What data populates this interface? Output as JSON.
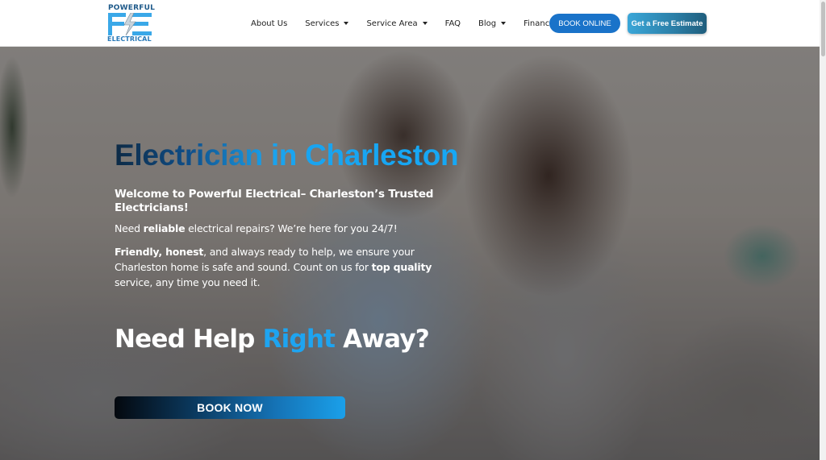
{
  "header": {
    "logo": {
      "top_text": "POWERFUL",
      "mark": "PE",
      "bottom_text": "ELECTRICAL",
      "brand_color": "#2a9fe0"
    },
    "nav": [
      {
        "label": "About Us",
        "has_dropdown": false
      },
      {
        "label": "Services",
        "has_dropdown": true
      },
      {
        "label": "Service Area",
        "has_dropdown": true
      },
      {
        "label": "FAQ",
        "has_dropdown": false
      },
      {
        "label": "Blog",
        "has_dropdown": true
      },
      {
        "label": "Financing",
        "has_dropdown": false
      }
    ],
    "book_online_label": "BOOK ONLINE",
    "estimate_label": "Get a Free Estimate"
  },
  "hero": {
    "title": "Electrician in Charleston",
    "welcome": "Welcome to Powerful Electrical– Charleston’s Trusted Electricians!",
    "p1": {
      "before": "Need ",
      "bold": "reliable",
      "after": " electrical repairs? We’re here for you 24/7!"
    },
    "p2": {
      "bold1": "Friendly, honest",
      "mid": ", and always ready to help, we ensure your Charleston home is safe and sound. Count on us for ",
      "bold2": "top quality",
      "after": " service, any time you need it."
    },
    "subheading": {
      "before": "Need Help ",
      "accent": "Right",
      "after": " Away?"
    },
    "book_now_label": "BOOK NOW"
  },
  "colors": {
    "accent_blue": "#1ea4f0",
    "book_online_bg": "#1a73c9",
    "estimate_bg": "#2b7ea6"
  }
}
